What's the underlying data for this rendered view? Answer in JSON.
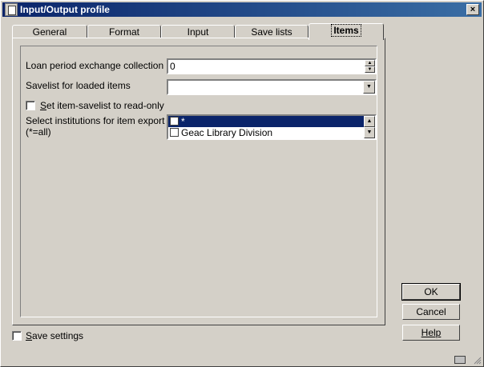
{
  "window": {
    "title": "Input/Output profile",
    "close_glyph": "×"
  },
  "tabs": [
    {
      "label": "General",
      "active": false
    },
    {
      "label": "Format",
      "active": false
    },
    {
      "label": "Input",
      "active": false
    },
    {
      "label": "Save lists",
      "active": false
    },
    {
      "label": "Items",
      "active": true
    }
  ],
  "items_tab": {
    "loan_period": {
      "label": "Loan period exchange collection",
      "value": "0"
    },
    "savelist_loaded": {
      "label": "Savelist for loaded items",
      "value": ""
    },
    "read_only": {
      "label_rest": "et item-savelist to read-only",
      "accel": "S",
      "checked": false
    },
    "institutions": {
      "label_line1": "Select institutions for item export",
      "label_line2": "(*=all)",
      "options": [
        {
          "text": "*",
          "selected": true,
          "checked": false
        },
        {
          "text": "Geac Library Division",
          "selected": false,
          "checked": false
        }
      ]
    }
  },
  "buttons": {
    "ok": "OK",
    "cancel": "Cancel",
    "help": "Help"
  },
  "save_settings": {
    "accel": "S",
    "label_rest": "ave settings",
    "checked": false
  },
  "colors": {
    "title_start": "#0a246a",
    "title_end": "#3a6ea5",
    "face": "#d4d0c8",
    "selection": "#0a246a"
  }
}
